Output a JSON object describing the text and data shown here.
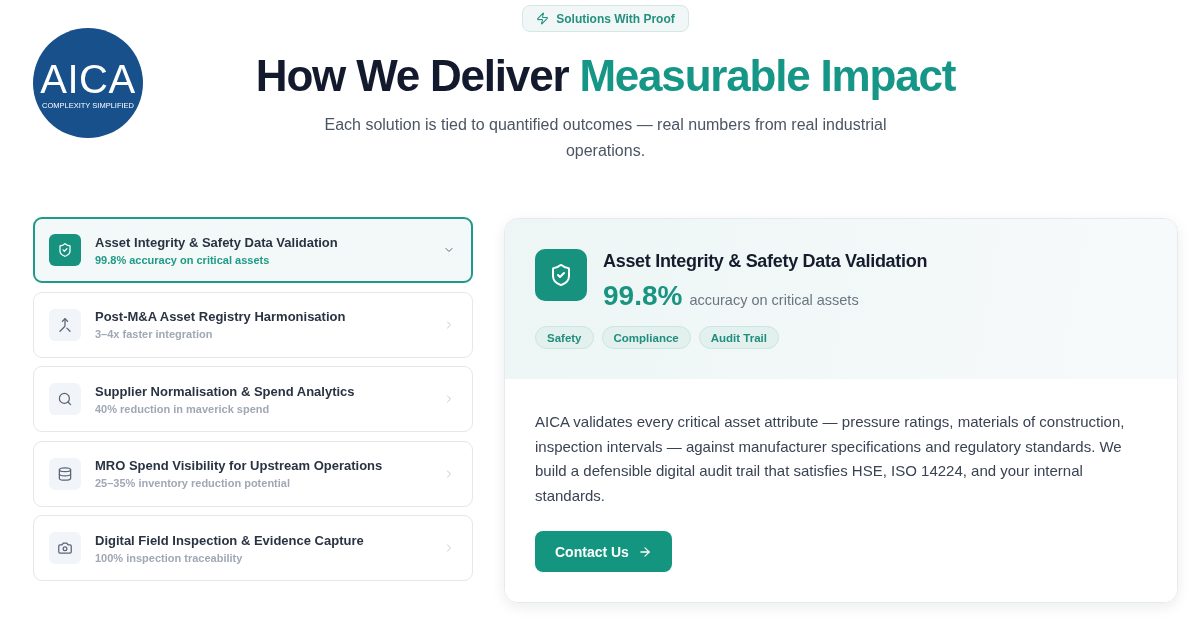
{
  "logo": {
    "name": "AICA",
    "tagline": "COMPLEXITY SIMPLIFIED"
  },
  "eyebrow": {
    "label": "Solutions With Proof"
  },
  "heading": {
    "text": "How We Deliver",
    "highlight": "Measurable Impact"
  },
  "subtitle": "Each solution is tied to quantified outcomes — real numbers from real industrial operations.",
  "solutions": [
    {
      "title": "Asset Integrity & Safety Data Validation",
      "outcome": "99.8% accuracy on critical assets",
      "selected": true
    },
    {
      "title": "Post-M&A Asset Registry Harmonisation",
      "outcome": "3–4x faster integration",
      "selected": false
    },
    {
      "title": "Supplier Normalisation & Spend Analytics",
      "outcome": "40% reduction in maverick spend",
      "selected": false
    },
    {
      "title": "MRO Spend Visibility for Upstream Operations",
      "outcome": "25–35% inventory reduction potential",
      "selected": false
    },
    {
      "title": "Digital Field Inspection & Evidence Capture",
      "outcome": "100% inspection traceability",
      "selected": false
    }
  ],
  "detail": {
    "title": "Asset Integrity & Safety Data Validation",
    "stat": "99.8%",
    "stat_label": "accuracy on critical assets",
    "tags": [
      "Safety",
      "Compliance",
      "Audit Trail"
    ],
    "description": "AICA validates every critical asset attribute — pressure ratings, materials of construction, inspection intervals — against manufacturer specifications and regulatory standards. We build a defensible digital audit trail that satisfies HSE, ISO 14224, and your internal standards.",
    "button": {
      "label": "Contact Us"
    }
  }
}
